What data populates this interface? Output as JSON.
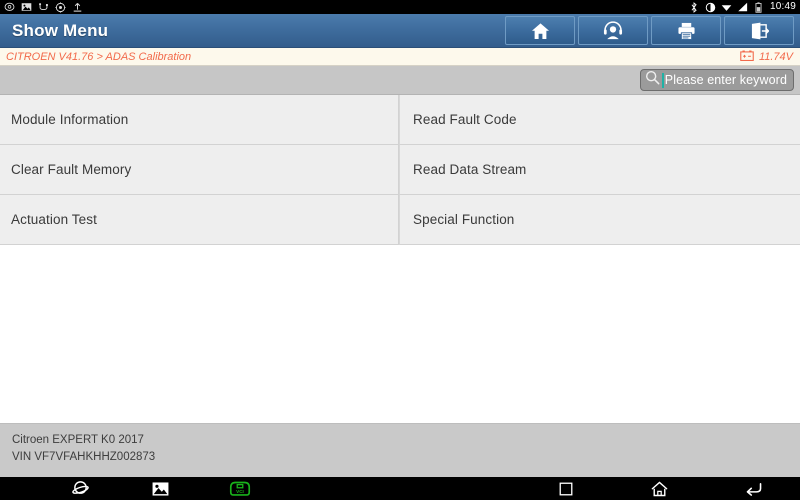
{
  "status_bar": {
    "left_icons": [
      {
        "name": "chat-bubble-icon",
        "glyph": "chat"
      },
      {
        "name": "screenshot-image-icon",
        "glyph": "image"
      },
      {
        "name": "usb-icon",
        "glyph": "usb"
      },
      {
        "name": "settings-gear-icon",
        "glyph": "gear"
      },
      {
        "name": "upload-arrow-icon",
        "glyph": "upload"
      }
    ],
    "right_icons": [
      {
        "name": "bluetooth-icon",
        "glyph": "bluetooth"
      },
      {
        "name": "brightness-icon",
        "glyph": "brightness"
      },
      {
        "name": "wifi-icon",
        "glyph": "wifi"
      },
      {
        "name": "cell-signal-icon",
        "glyph": "signal"
      },
      {
        "name": "battery-icon",
        "glyph": "battery"
      }
    ],
    "time": "10:49"
  },
  "title_bar": {
    "title": "Show Menu",
    "buttons": [
      {
        "name": "home-button",
        "icon": "home-icon"
      },
      {
        "name": "support-button",
        "icon": "headset-icon"
      },
      {
        "name": "print-button",
        "icon": "printer-icon"
      },
      {
        "name": "exit-button",
        "icon": "exit-icon"
      }
    ]
  },
  "breadcrumb": {
    "path": "CITROEN V41.76 > ADAS Calibration",
    "voltage": "11.74V",
    "voltage_icon": "car-battery-icon",
    "accent_color": "#f26a4b"
  },
  "search": {
    "icon": "search-icon",
    "placeholder": "Please enter keyword",
    "value": "",
    "caret_color": "#1fb2a6"
  },
  "menu": {
    "items": [
      {
        "label": "Module Information",
        "column": "left"
      },
      {
        "label": "Read Fault Code",
        "column": "right"
      },
      {
        "label": "Clear Fault Memory",
        "column": "left"
      },
      {
        "label": "Read Data Stream",
        "column": "right"
      },
      {
        "label": "Actuation Test",
        "column": "left"
      },
      {
        "label": "Special Function",
        "column": "right"
      }
    ]
  },
  "vehicle_info": {
    "model": "Citroen EXPERT K0 2017",
    "vin": "VIN VF7VFAHKHHZ002873"
  },
  "nav_bar": {
    "left_items": [
      {
        "name": "browser-icon",
        "glyph": "planet"
      },
      {
        "name": "gallery-icon",
        "glyph": "image"
      },
      {
        "name": "vci-connector-icon",
        "glyph": "vci",
        "label": "VCI",
        "color": "#19b21b"
      }
    ],
    "right_items": [
      {
        "name": "recents-button",
        "glyph": "square"
      },
      {
        "name": "home-button",
        "glyph": "home"
      },
      {
        "name": "back-button",
        "glyph": "back"
      }
    ]
  }
}
